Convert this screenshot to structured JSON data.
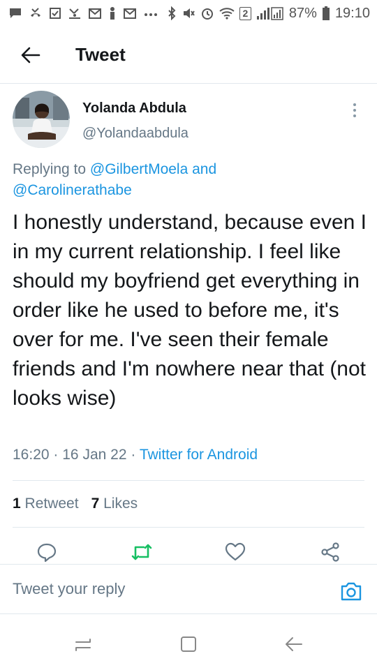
{
  "status_bar": {
    "battery_percent": "87%",
    "time": "19:10",
    "sim_badge": "2",
    "icons": [
      "message-icon",
      "missed-call-icon",
      "checkbox-icon",
      "gesture-icon",
      "gmail-icon",
      "person-icon",
      "gmail-icon",
      "more-dots-icon",
      "bluetooth-icon",
      "mute-icon",
      "alarm-icon",
      "wifi-icon",
      "signal-icon",
      "battery-icon"
    ]
  },
  "header": {
    "title": "Tweet",
    "back_icon": "arrow-left-icon"
  },
  "tweet": {
    "author_name": "Yolanda Abdula",
    "author_handle": "@Yolandaabdula",
    "replying_prefix": "Replying to",
    "mention_1": "@GilbertMoela",
    "replying_and": "and",
    "mention_2": "@Carolinerathabe",
    "text": "I honestly understand, because even I in my current relationship. I feel like should my boyfriend get everything in order like he used to before me, it's over for me. I've seen their female friends and I'm nowhere near that (not looks wise)",
    "time": "16:20",
    "date": "16 Jan 22",
    "separator": "·",
    "source": "Twitter for Android",
    "retweet_count": "1",
    "retweet_label": "Retweet",
    "like_count": "7",
    "like_label": "Likes"
  },
  "actions": {
    "reply_icon": "reply-icon",
    "retweet_icon": "retweet-icon",
    "like_icon": "heart-icon",
    "share_icon": "share-icon"
  },
  "reply_bar": {
    "placeholder": "Tweet your reply",
    "camera_icon": "camera-icon"
  },
  "colors": {
    "link": "#1b95e0",
    "retweet_green": "#17bf63",
    "secondary_text": "#657786",
    "divider": "#e1e8ed"
  }
}
